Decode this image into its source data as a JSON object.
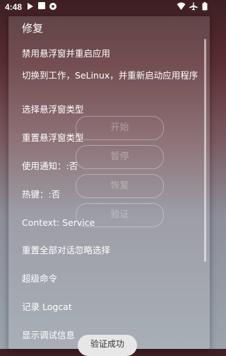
{
  "status_bar": {
    "time": "4:48",
    "left_icons": [
      "media-icon",
      "notification-icon",
      "app-icon"
    ],
    "right_icons": [
      "wifi-icon",
      "airplane-icon",
      "battery-icon"
    ]
  },
  "background_buttons": [
    "开始",
    "暂停",
    "恢复",
    "验证"
  ],
  "menu": {
    "title": "修复",
    "items": [
      "禁用悬浮窗并重启应用",
      "切换到工作，SeLinux，并重新启动应用程序",
      "选择悬浮窗类型",
      "重置悬浮窗类型",
      "使用通知：:否",
      "热键：:否",
      "Context: Service",
      "重置全部对话忽略选择",
      "超级命令",
      "记录 Logcat",
      "显示调试信息"
    ]
  },
  "toast": "验证成功"
}
